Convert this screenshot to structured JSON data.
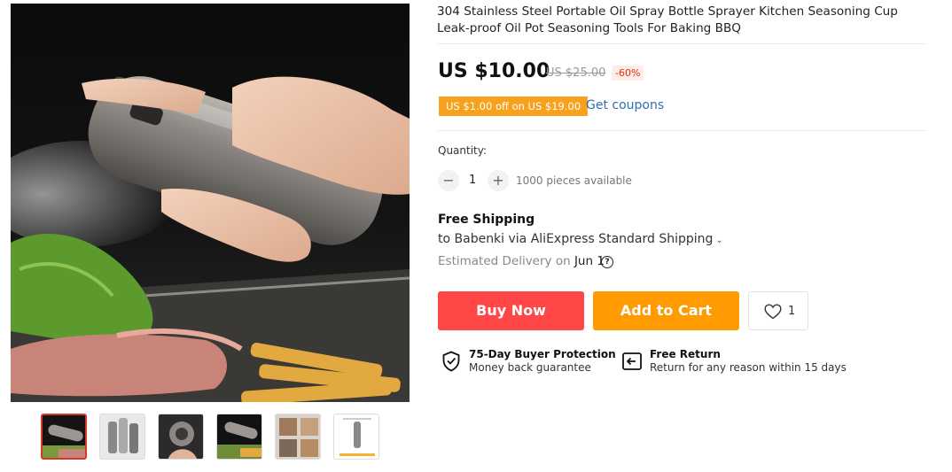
{
  "product": {
    "title": "304 Stainless Steel Portable Oil Spray Bottle Sprayer Kitchen Seasoning Cup Leak-proof Oil Pot Seasoning Tools For Baking BBQ"
  },
  "price": {
    "current": "US $10.00",
    "original": "US $25.00",
    "discount": "-60%"
  },
  "coupon": {
    "badge": "US $1.00 off on US $19.00",
    "link": "Get coupons"
  },
  "quantity": {
    "label": "Quantity:",
    "minus": "−",
    "value": "1",
    "plus": "+",
    "available": "1000 pieces available"
  },
  "shipping": {
    "title": "Free Shipping",
    "route": "to Babenki via AliExpress Standard Shipping",
    "estimated_label": "Estimated Delivery on",
    "date": "Jun 1",
    "help": "?"
  },
  "actions": {
    "buy_now": "Buy Now",
    "add_to_cart": "Add to Cart",
    "wishlist_count": "1"
  },
  "features": [
    {
      "title": "75-Day Buyer Protection",
      "subtitle": "Money back guarantee",
      "icon": "shield-check-icon"
    },
    {
      "title": "Free Return",
      "subtitle": "Return for any reason within 15 days",
      "icon": "return-box-icon"
    }
  ],
  "colors": {
    "buy": "#ff4747",
    "cart": "#ff9a00",
    "coupon": "#f7a11c",
    "link": "#2e6fb7",
    "active_thumb_border": "#d9362b"
  }
}
